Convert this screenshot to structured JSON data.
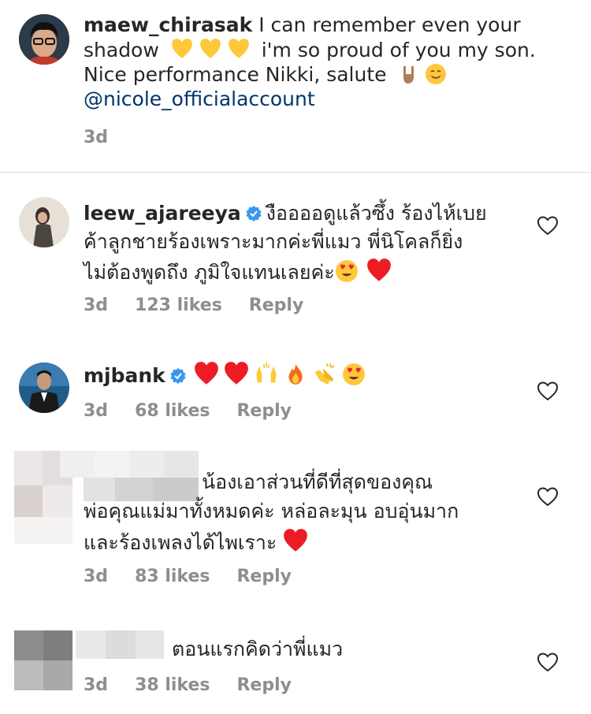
{
  "comments": [
    {
      "username": "maew_chirasak",
      "text_1": "I can remember even your",
      "text_2": "shadow",
      "text_3": "i'm so proud of you my son.",
      "text_4": "Nice performance Nikki, salute",
      "mention": "@nicole_officialaccount",
      "time": "3d"
    },
    {
      "username": "leew_ajareeya",
      "text_1": "งืออออดูแล้วซึ้ง ร้องไห้เบย",
      "text_2": "ค้าลูกชายร้องเพราะมากค่ะพี่แมว พี่นิโคลก็ยิ่ง",
      "text_3": "ไม่ต้องพูดถึง ภูมิใจแทนเลยค่ะ",
      "time": "3d",
      "likes": "123 likes",
      "reply": "Reply"
    },
    {
      "username": "mjbank",
      "time": "3d",
      "likes": "68 likes",
      "reply": "Reply"
    },
    {
      "text_1": "น้องเอาส่วนที่ดีที่สุดของคุณ",
      "text_2": "พ่อคุณแม่มาทั้งหมดค่ะ หล่อละมุน อบอุ่นมาก",
      "text_3": "และร้องเพลงได้ไพเราะ",
      "time": "3d",
      "likes": "83 likes",
      "reply": "Reply"
    },
    {
      "text_1": "ตอนแรกคิดว่าพี่แมว",
      "time": "3d",
      "likes": "38 likes",
      "reply": "Reply"
    }
  ],
  "colors": {
    "text": "#262626",
    "meta": "#8e8e8e",
    "mention": "#003569",
    "verified": "#3897f0",
    "heart_red": "#ed1c24"
  }
}
